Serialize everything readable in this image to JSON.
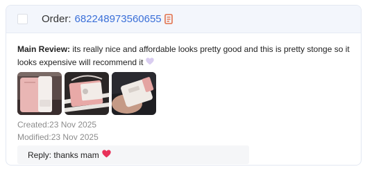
{
  "order": {
    "label": "Order:",
    "number": "682248973560655",
    "copy_icon": "copy-document-icon",
    "checkbox_checked": false
  },
  "review": {
    "label": "Main Review:",
    "text": " its really nice and affordable looks pretty good and this is pretty stonge so it looks expensive will recommend it",
    "emoji_icon": "lavender-heart-icon"
  },
  "photos": [
    {
      "name": "review-photo-1",
      "description": "pink phone case"
    },
    {
      "name": "review-photo-2",
      "description": "pink crossbody phone bag"
    },
    {
      "name": "review-photo-3",
      "description": "phone case held in hand"
    }
  ],
  "meta": {
    "created": "Created:23 Nov 2025",
    "modified": "Modified:23 Nov 2025"
  },
  "reply": {
    "text": "Reply: thanks mam",
    "emoji_icon": "red-heart-icon"
  },
  "colors": {
    "accent": "#3a6fd8",
    "copy_icon": "#e2704a",
    "header_bg": "#f3f6fc",
    "reply_bg": "#f5f6f8",
    "meta_text": "#8c8c8c"
  }
}
